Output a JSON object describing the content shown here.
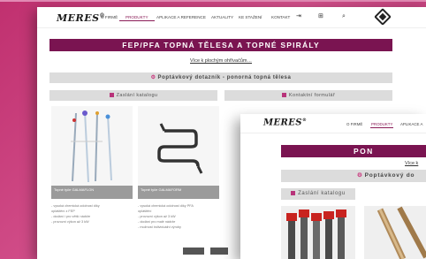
{
  "page": {
    "nav": [
      "O FIRMĚ",
      "PRODUKTY",
      "APLIKACE A REFERENCE",
      "AKTUALITY",
      "KE STAŽENÍ",
      "KONTAKT"
    ],
    "nav_front": [
      "O FIRMĚ",
      "PRODUKTY",
      "APLIKACE A"
    ],
    "title": "FEP/PFA TOPNÁ TĚLESA A TOPNÉ SPIRÁLY",
    "title_front": "PON",
    "link": "Více k plochým ohřívačům…",
    "link_front": "Více k",
    "inquiry": "Poptávkový dotazník - ponorná topná tělesa",
    "inquiry_front": "Poptávkový do",
    "catalog": "Zaslání katalogu",
    "contact_form": "Kontaktní formulář",
    "cards": [
      {
        "caption": "Topné tyče GALMAFLON"
      },
      {
        "caption": "Topné tyče GALMAFORM"
      }
    ],
    "bullets_1": [
      "- vysoká chemická odolnost díky",
      "opláštění z FEP",
      "- dodání i pro větší nádrže",
      "- provozní výkon až 3 kW"
    ],
    "bullets_2": [
      "- vysoká chemická odolnost díky PFA",
      "opláštění",
      "- provozní výkon až 3 kW",
      "- dodání pro malé nádrže",
      "- možnost individuální výroby"
    ]
  },
  "icons": {
    "gear": "gear-icon",
    "book": "book-icon",
    "mail": "mail-icon",
    "cart": "cart-icon",
    "search": "search-icon",
    "login": "login-icon"
  },
  "colors": {
    "brand": "#7a1451",
    "accent": "#c93a7f",
    "background": "#c0306f"
  }
}
